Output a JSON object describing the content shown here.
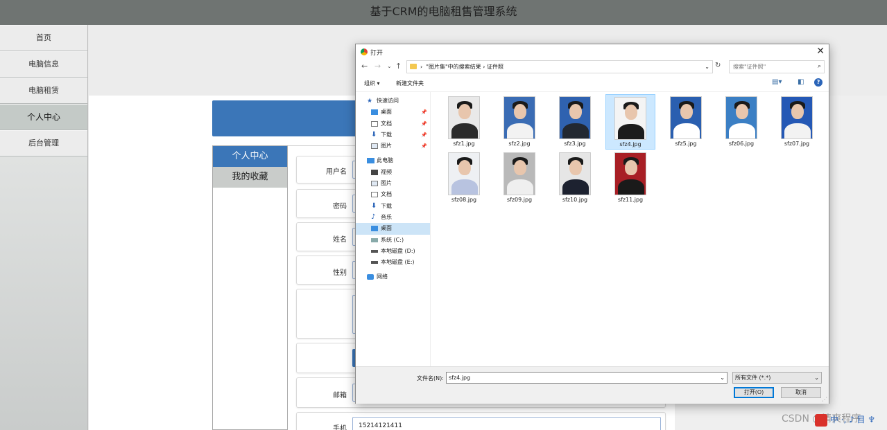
{
  "app": {
    "title": "基于CRM的电脑租售管理系统"
  },
  "sidebar": {
    "items": [
      {
        "label": "首页"
      },
      {
        "label": "电脑信息"
      },
      {
        "label": "电脑租赁"
      },
      {
        "label": "个人中心"
      },
      {
        "label": "后台管理"
      }
    ],
    "active_index": 3
  },
  "personal": {
    "tabs": [
      {
        "label": "个人中心"
      },
      {
        "label": "我的收藏"
      }
    ],
    "form": {
      "username_label": "用户名",
      "password_label": "密码",
      "name_label": "姓名",
      "gender_label": "性别",
      "email_label": "邮箱",
      "phone_label": "手机",
      "phone_value": "15214121411"
    }
  },
  "dialog": {
    "title": "打开",
    "breadcrumb": "\"图片集\"中的搜索结果  ›  证件照",
    "search_placeholder": "搜索\"证件照\"",
    "toolbar": {
      "organize": "组织 ▾",
      "new_folder": "新建文件夹"
    },
    "nav_groups": [
      {
        "label": "快速访问",
        "items": [
          "桌面",
          "文档",
          "下载",
          "图片"
        ]
      },
      {
        "label": "此电脑",
        "items": [
          "视频",
          "图片",
          "文档",
          "下载",
          "音乐",
          "桌面",
          "系统 (C:)",
          "本地磁盘 (D:)",
          "本地磁盘 (E:)"
        ]
      },
      {
        "label": "网络",
        "items": []
      }
    ],
    "files": [
      {
        "name": "sfz1.jpg",
        "bg": "#e9e9e9",
        "cloth": "#2b2b2b"
      },
      {
        "name": "sfz2.jpg",
        "bg": "#3a6cb4",
        "cloth": "#f2f2f2"
      },
      {
        "name": "sfz3.jpg",
        "bg": "#2f62b0",
        "cloth": "#222831"
      },
      {
        "name": "sfz4.jpg",
        "bg": "#f4f4f4",
        "cloth": "#1b1b1b"
      },
      {
        "name": "sfz5.jpg",
        "bg": "#2a5fb0",
        "cloth": "#ffffff"
      },
      {
        "name": "sfz06.jpg",
        "bg": "#3b7fc4",
        "cloth": "#ffffff"
      },
      {
        "name": "sfz07.jpg",
        "bg": "#2458b5",
        "cloth": "#f2f2f2"
      },
      {
        "name": "sfz08.jpg",
        "bg": "#eef0f3",
        "cloth": "#b8c3e0"
      },
      {
        "name": "sfz09.jpg",
        "bg": "#b9b9b9",
        "cloth": "#efefef"
      },
      {
        "name": "sfz10.jpg",
        "bg": "#e6e6e6",
        "cloth": "#1d2230"
      },
      {
        "name": "sfz11.jpg",
        "bg": "#a81f25",
        "cloth": "#1a1a1a"
      }
    ],
    "selected_file_index": 3,
    "filename_label": "文件名(N):",
    "filename_value": "sfz4.jpg",
    "filetype_value": "所有文件 (*.*)",
    "open_button": "打开(O)",
    "cancel_button": "取消"
  },
  "watermark": "CSDN @清爽程序",
  "tray_text": "中 ·, ♪ 目 ♆"
}
